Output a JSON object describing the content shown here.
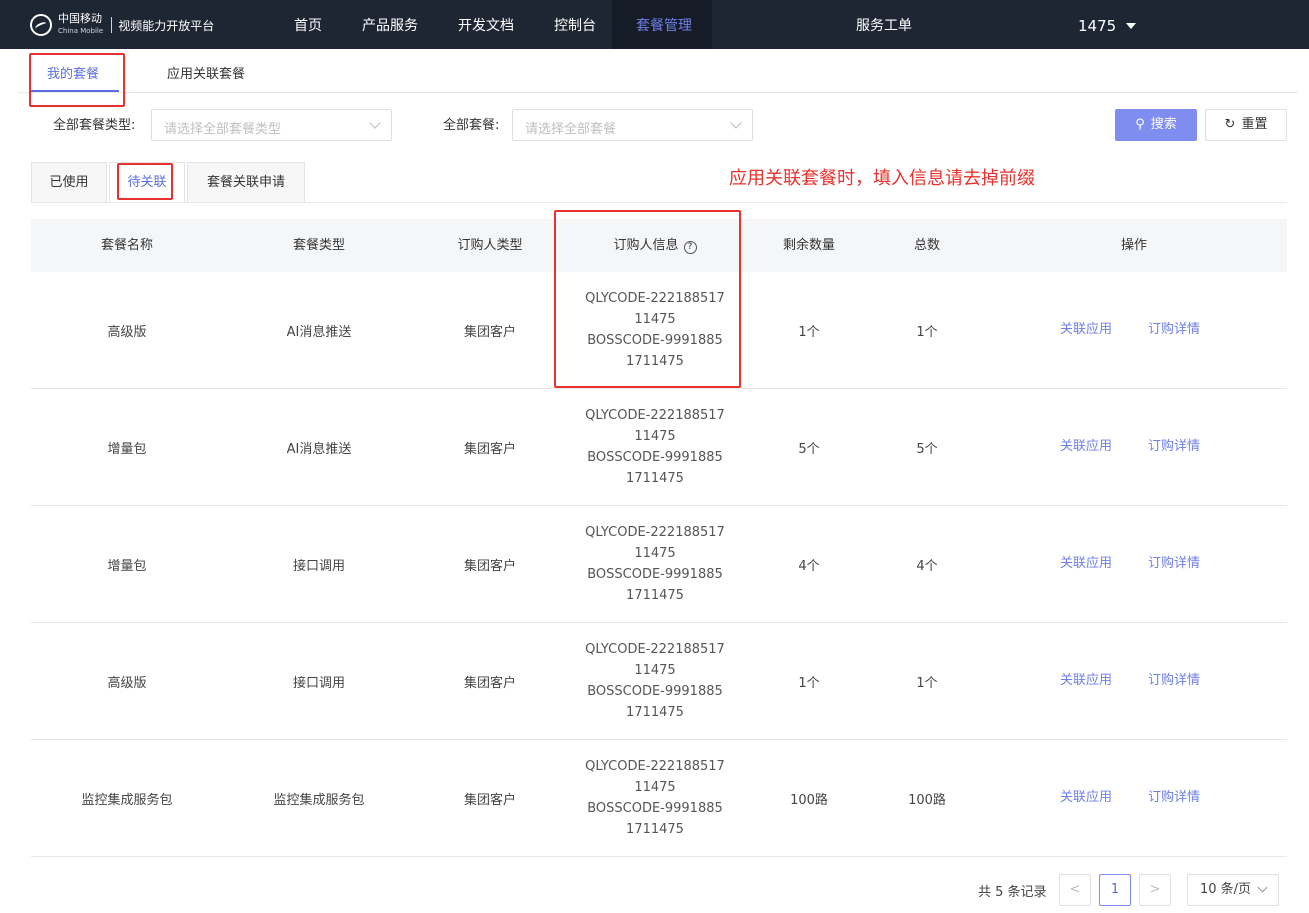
{
  "header": {
    "logo_cn": "中国移动",
    "logo_en": "China Mobile",
    "platform": "视频能力开放平台",
    "nav": [
      "首页",
      "产品服务",
      "开发文档",
      "控制台",
      "套餐管理"
    ],
    "service": "服务工单",
    "user": "1475"
  },
  "main_tabs": [
    "我的套餐",
    "应用关联套餐"
  ],
  "filters": {
    "type_label": "全部套餐类型:",
    "type_placeholder": "请选择全部套餐类型",
    "package_label": "全部套餐:",
    "package_placeholder": "请选择全部套餐",
    "search": "搜索",
    "reset": "重置"
  },
  "sub_tabs": [
    "已使用",
    "待关联",
    "套餐关联申请"
  ],
  "annotation": "应用关联套餐时，填入信息请去掉前缀",
  "table": {
    "headers": [
      "套餐名称",
      "套餐类型",
      "订购人类型",
      "订购人信息",
      "剩余数量",
      "总数",
      "操作"
    ],
    "rows": [
      {
        "name": "高级版",
        "type": "AI消息推送",
        "buyer_type": "集团客户",
        "info": [
          "QLYCODE-222188517",
          "11475",
          "BOSSCODE-9991885",
          "1711475"
        ],
        "remain": "1个",
        "total": "1个",
        "op1": "关联应用",
        "op2": "订购详情"
      },
      {
        "name": "增量包",
        "type": "AI消息推送",
        "buyer_type": "集团客户",
        "info": [
          "QLYCODE-222188517",
          "11475",
          "BOSSCODE-9991885",
          "1711475"
        ],
        "remain": "5个",
        "total": "5个",
        "op1": "关联应用",
        "op2": "订购详情"
      },
      {
        "name": "增量包",
        "type": "接口调用",
        "buyer_type": "集团客户",
        "info": [
          "QLYCODE-222188517",
          "11475",
          "BOSSCODE-9991885",
          "1711475"
        ],
        "remain": "4个",
        "total": "4个",
        "op1": "关联应用",
        "op2": "订购详情"
      },
      {
        "name": "高级版",
        "type": "接口调用",
        "buyer_type": "集团客户",
        "info": [
          "QLYCODE-222188517",
          "11475",
          "BOSSCODE-9991885",
          "1711475"
        ],
        "remain": "1个",
        "total": "1个",
        "op1": "关联应用",
        "op2": "订购详情"
      },
      {
        "name": "监控集成服务包",
        "type": "监控集成服务包",
        "buyer_type": "集团客户",
        "info": [
          "QLYCODE-222188517",
          "11475",
          "BOSSCODE-9991885",
          "1711475"
        ],
        "remain": "100路",
        "total": "100路",
        "op1": "关联应用",
        "op2": "订购详情"
      }
    ]
  },
  "pagination": {
    "total": "共 5 条记录",
    "prev": "<",
    "page": "1",
    "next": ">",
    "size": "10 条/页"
  },
  "colors": {
    "accent": "#5b6ee0",
    "annotation": "#e8322d",
    "nav_bg": "#1f2633"
  }
}
